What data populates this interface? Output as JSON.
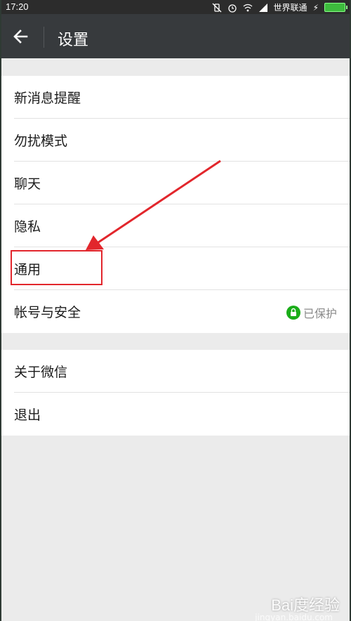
{
  "status_bar": {
    "time": "17:20",
    "carrier": "世界联通",
    "battery_level": 1.0
  },
  "header": {
    "title": "设置"
  },
  "group1": [
    {
      "label": "新消息提醒"
    },
    {
      "label": "勿扰模式"
    },
    {
      "label": "聊天"
    },
    {
      "label": "隐私"
    },
    {
      "label": "通用"
    },
    {
      "label": "帐号与安全",
      "status": "已保护"
    }
  ],
  "group2": [
    {
      "label": "关于微信"
    },
    {
      "label": "退出"
    }
  ],
  "watermark": {
    "text": "Bai度经验",
    "sub": "jingyan.baidu.com"
  },
  "colors": {
    "header_bg": "#373a3d",
    "page_bg": "#ebebeb",
    "annotation": "#e2262c",
    "lock_green": "#1aad19"
  }
}
